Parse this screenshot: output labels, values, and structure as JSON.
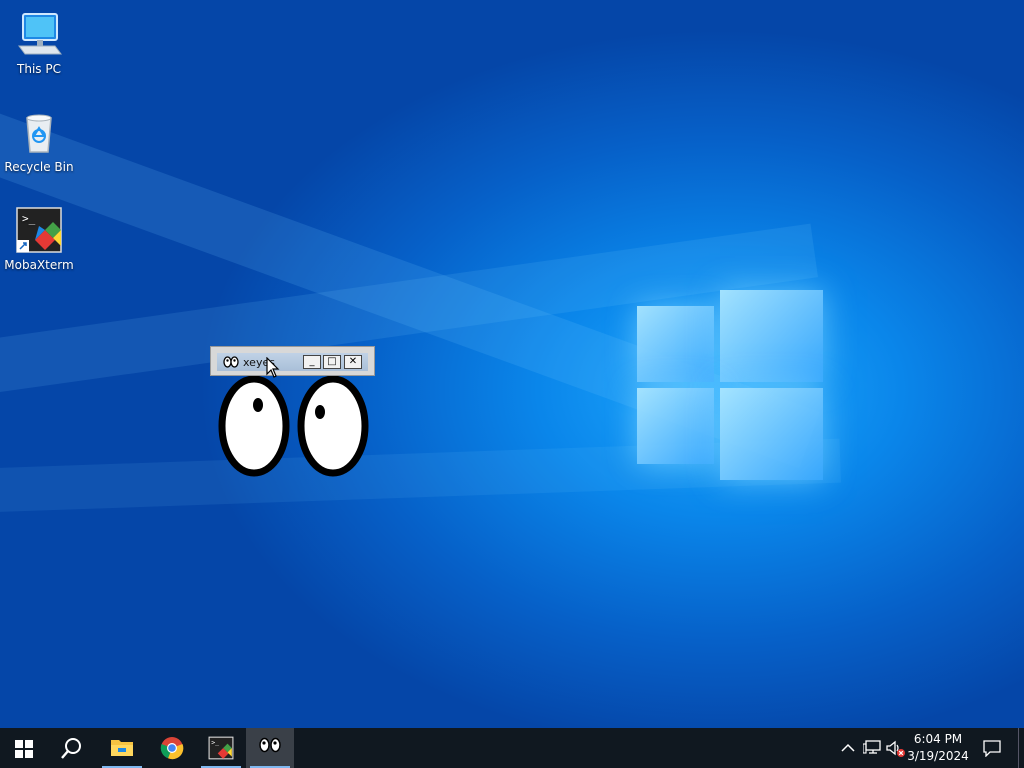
{
  "desktop": {
    "icons": [
      {
        "label": "This PC",
        "icon": "computer-icon"
      },
      {
        "label": "Recycle Bin",
        "icon": "recycle-bin-icon"
      },
      {
        "label": "MobaXterm",
        "icon": "mobaxterm-icon"
      }
    ]
  },
  "xeyes_window": {
    "title": "xeyes",
    "buttons": {
      "minimize": "_",
      "maximize": "□",
      "close": "✕"
    }
  },
  "taskbar": {
    "items": [
      "start-icon",
      "search-icon",
      "file-explorer-icon",
      "chrome-icon",
      "mobaxterm-icon",
      "xeyes-icon"
    ],
    "active_item": "xeyes-icon",
    "clock": {
      "time": "6:04 PM",
      "date": "3/19/2024"
    },
    "tray": [
      "chevron-up-icon",
      "network-icon",
      "volume-muted-icon",
      "notification-icon"
    ]
  },
  "colors": {
    "wallpaper": "#0a86ea",
    "taskbar": "#101820",
    "accent": "#7fb8f0"
  }
}
